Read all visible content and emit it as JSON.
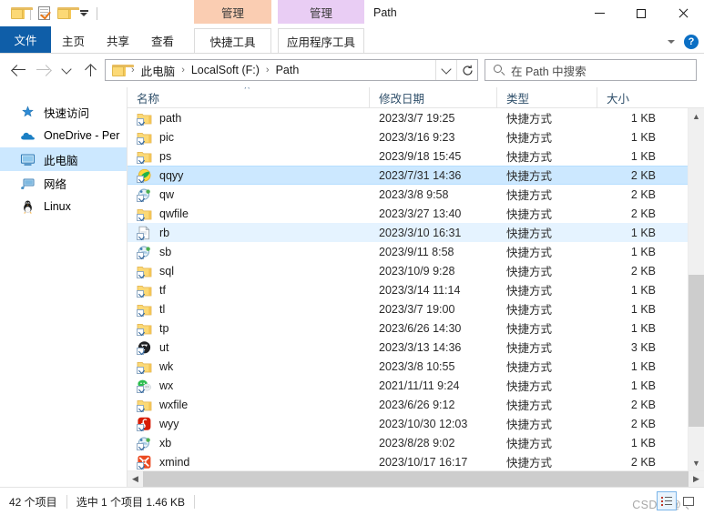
{
  "window": {
    "title": "Path",
    "controls": {
      "minimize": "—",
      "maximize": "□",
      "close": "✕"
    }
  },
  "quick_access_toolbar": {
    "items": [
      {
        "name": "folder-icon",
        "label": ""
      },
      {
        "name": "properties-icon",
        "label": ""
      },
      {
        "name": "new-folder-icon",
        "label": ""
      },
      {
        "name": "customize-dropdown",
        "label": ""
      }
    ]
  },
  "ribbon": {
    "tabs": [
      {
        "label": "文件",
        "selected": true
      },
      {
        "label": "主页",
        "selected": false
      },
      {
        "label": "共享",
        "selected": false
      },
      {
        "label": "查看",
        "selected": false
      }
    ],
    "contextual_groups": [
      {
        "group_label": "管理",
        "tab_label": "快捷工具",
        "color": "#facdb2"
      },
      {
        "group_label": "管理",
        "tab_label": "应用程序工具",
        "color": "#e9cdf4"
      }
    ],
    "collapse_label": "",
    "help_label": "?"
  },
  "address_bar": {
    "back_tooltip": "",
    "forward_tooltip": "",
    "recent_tooltip": "",
    "up_tooltip": "",
    "breadcrumbs": [
      "此电脑",
      "LocalSoft (F:)",
      "Path"
    ],
    "separator": "›",
    "refresh_label": ""
  },
  "search": {
    "placeholder": "在 Path 中搜索",
    "value": ""
  },
  "nav_pane": {
    "items": [
      {
        "label": "快速访问",
        "icon": "star-pin-icon",
        "selected": false
      },
      {
        "label": "OneDrive - Per",
        "icon": "onedrive-cloud-icon",
        "selected": false
      },
      {
        "label": "此电脑",
        "icon": "this-pc-monitor-icon",
        "selected": true
      },
      {
        "label": "网络",
        "icon": "network-icon",
        "selected": false
      },
      {
        "label": "Linux",
        "icon": "linux-penguin-icon",
        "selected": false
      }
    ]
  },
  "file_list": {
    "columns": [
      {
        "label": "名称",
        "key": "name",
        "sorted": "asc"
      },
      {
        "label": "修改日期",
        "key": "date"
      },
      {
        "label": "类型",
        "key": "type"
      },
      {
        "label": "大小",
        "key": "size"
      }
    ],
    "sort_indicator": "˄",
    "rows": [
      {
        "name": "path",
        "date": "2023/3/7 19:25",
        "type": "快捷方式",
        "size": "1 KB",
        "icon": "folder-shortcut-icon",
        "state": "normal"
      },
      {
        "name": "pic",
        "date": "2023/3/16 9:23",
        "type": "快捷方式",
        "size": "1 KB",
        "icon": "folder-shortcut-icon",
        "state": "normal"
      },
      {
        "name": "ps",
        "date": "2023/9/18 15:45",
        "type": "快捷方式",
        "size": "1 KB",
        "icon": "folder-shortcut-icon",
        "state": "normal"
      },
      {
        "name": "qqyy",
        "date": "2023/7/31 14:36",
        "type": "快捷方式",
        "size": "2 KB",
        "icon": "qq-music-shortcut-icon",
        "state": "selected"
      },
      {
        "name": "qw",
        "date": "2023/3/8 9:58",
        "type": "快捷方式",
        "size": "2 KB",
        "icon": "app-shortcut-icon",
        "state": "normal"
      },
      {
        "name": "qwfile",
        "date": "2023/3/27 13:40",
        "type": "快捷方式",
        "size": "2 KB",
        "icon": "folder-shortcut-icon",
        "state": "normal"
      },
      {
        "name": "rb",
        "date": "2023/3/10 16:31",
        "type": "快捷方式",
        "size": "1 KB",
        "icon": "file-shortcut-icon",
        "state": "highlighted"
      },
      {
        "name": "sb",
        "date": "2023/9/11 8:58",
        "type": "快捷方式",
        "size": "1 KB",
        "icon": "app-shortcut-icon",
        "state": "normal"
      },
      {
        "name": "sql",
        "date": "2023/10/9 9:28",
        "type": "快捷方式",
        "size": "2 KB",
        "icon": "folder-shortcut-icon",
        "state": "normal"
      },
      {
        "name": "tf",
        "date": "2023/3/14 11:14",
        "type": "快捷方式",
        "size": "1 KB",
        "icon": "folder-shortcut-icon",
        "state": "normal"
      },
      {
        "name": "tl",
        "date": "2023/3/7 19:00",
        "type": "快捷方式",
        "size": "1 KB",
        "icon": "folder-shortcut-icon",
        "state": "normal"
      },
      {
        "name": "tp",
        "date": "2023/6/26 14:30",
        "type": "快捷方式",
        "size": "1 KB",
        "icon": "folder-shortcut-icon",
        "state": "normal"
      },
      {
        "name": "ut",
        "date": "2023/3/13 14:36",
        "type": "快捷方式",
        "size": "3 KB",
        "icon": "utools-shortcut-icon",
        "state": "normal"
      },
      {
        "name": "wk",
        "date": "2023/3/8 10:55",
        "type": "快捷方式",
        "size": "1 KB",
        "icon": "folder-shortcut-icon",
        "state": "normal"
      },
      {
        "name": "wx",
        "date": "2021/11/11 9:24",
        "type": "快捷方式",
        "size": "1 KB",
        "icon": "wechat-shortcut-icon",
        "state": "normal"
      },
      {
        "name": "wxfile",
        "date": "2023/6/26 9:12",
        "type": "快捷方式",
        "size": "2 KB",
        "icon": "folder-shortcut-icon",
        "state": "normal"
      },
      {
        "name": "wyy",
        "date": "2023/10/30 12:03",
        "type": "快捷方式",
        "size": "2 KB",
        "icon": "netease-music-shortcut-icon",
        "state": "normal"
      },
      {
        "name": "xb",
        "date": "2023/8/28 9:02",
        "type": "快捷方式",
        "size": "1 KB",
        "icon": "app-shortcut-icon",
        "state": "normal"
      },
      {
        "name": "xmind",
        "date": "2023/10/17 16:17",
        "type": "快捷方式",
        "size": "2 KB",
        "icon": "xmind-shortcut-icon",
        "state": "normal"
      }
    ]
  },
  "status_bar": {
    "item_count": "42 个项目",
    "selection": "选中 1 个项目  1.46 KB",
    "watermark": "CSDN @ 、",
    "view_modes": [
      {
        "name": "details-view",
        "active": true
      },
      {
        "name": "large-icons-view",
        "active": false
      }
    ]
  }
}
